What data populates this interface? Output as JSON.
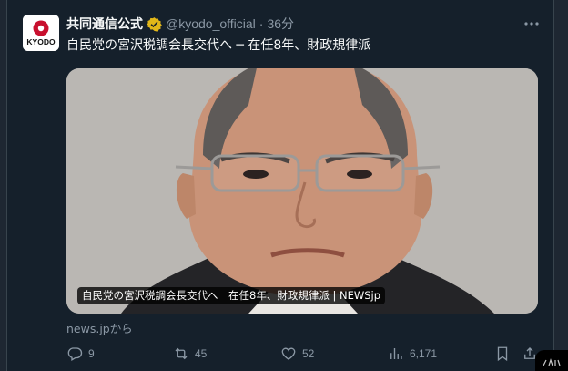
{
  "tweet": {
    "author_name": "共同通信公式",
    "handle": "@kyodo_official",
    "separator": "·",
    "time": "36分",
    "text": "自民党の宮沢税調会長交代へ ─ 在任8年、財政規律派",
    "more_icon": "more-icon"
  },
  "avatar": {
    "logo_text": "KYODO",
    "logo_color": "#c8102e"
  },
  "card": {
    "caption": "自民党の宮沢税調会長交代へ　在任8年、財政規律派 | NEWSjp",
    "source": "news.jpから"
  },
  "actions": {
    "reply_count": "9",
    "retweet_count": "45",
    "like_count": "52",
    "views_count": "6,171"
  },
  "colors": {
    "background": "#15202b",
    "secondary_text": "#8b98a5",
    "verified_badge": "#e2b719"
  }
}
